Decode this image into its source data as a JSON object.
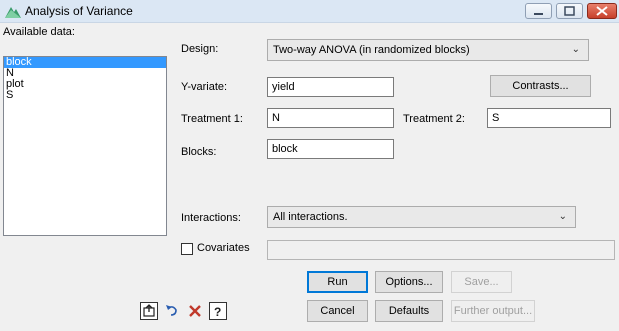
{
  "window": {
    "title": "Analysis of Variance"
  },
  "available": {
    "label": "Available data:",
    "items": [
      "block",
      "N",
      "plot",
      "S"
    ],
    "selected": "block"
  },
  "design": {
    "label": "Design:",
    "value": "Two-way ANOVA (in randomized blocks)"
  },
  "yvariate": {
    "label": "Y-variate:",
    "value": "yield"
  },
  "contrasts": {
    "label": "Contrasts..."
  },
  "treatment1": {
    "label": "Treatment 1:",
    "value": "N"
  },
  "treatment2": {
    "label": "Treatment 2:",
    "value": "S"
  },
  "blocks": {
    "label": "Blocks:",
    "value": "block"
  },
  "interactions": {
    "label": "Interactions:",
    "value": "All interactions."
  },
  "covariates": {
    "label": "Covariates",
    "value": ""
  },
  "buttons": {
    "run": "Run",
    "options": "Options...",
    "save": "Save...",
    "cancel": "Cancel",
    "defaults": "Defaults",
    "further": "Further output..."
  },
  "icons": [
    "transfer-icon",
    "undo-icon",
    "clear-icon",
    "help-icon"
  ],
  "colors": {
    "selection": "#3399ff",
    "titlebar": "#dbe7f4",
    "close": "#c7402b"
  }
}
